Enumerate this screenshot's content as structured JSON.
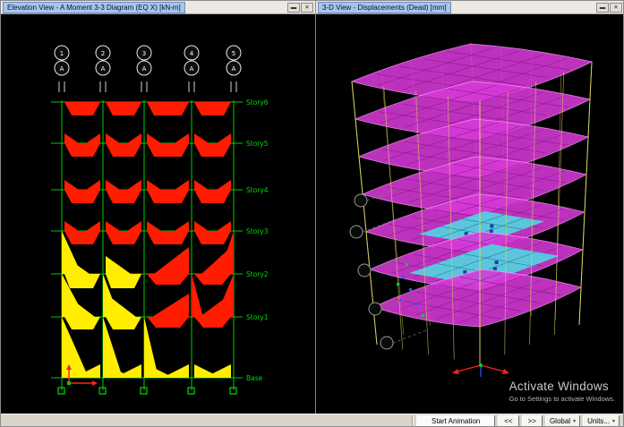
{
  "left_panel": {
    "title": "Elevation View - A   Moment 3-3 Diagram   (EQ X)  [kN-m]",
    "grid_numbers": [
      "1",
      "2",
      "3",
      "4",
      "5"
    ],
    "grid_letters": [
      "A",
      "A",
      "A",
      "A",
      "A"
    ],
    "story_labels": [
      "Story6",
      "Story5",
      "Story4",
      "Story3",
      "Story2",
      "Story1",
      "Base"
    ]
  },
  "right_panel": {
    "title": "3-D View  - Displacements (Dead)  [mm]",
    "watermark_line1": "Activate Windows",
    "watermark_line2": "Go to Settings to activate Windows."
  },
  "window_buttons": {
    "minimize_glyph": "▬",
    "close_glyph": "✕"
  },
  "status_bar": {
    "start_animation_label": "Start Animation",
    "step_back_label": "<<",
    "step_forward_label": ">>",
    "coord_system_value": "Global",
    "units_value": "Units...",
    "dropdown_arrow": "▾"
  },
  "colors": {
    "moment_red": "#ff1c00",
    "moment_yellow": "#ffee00",
    "grid_green": "#00d800",
    "slab_magenta": "#d839d8",
    "slab_grid": "#8a1090",
    "contour_cyan": "#52d2e0",
    "frame_yellow": "#ddd45f"
  }
}
